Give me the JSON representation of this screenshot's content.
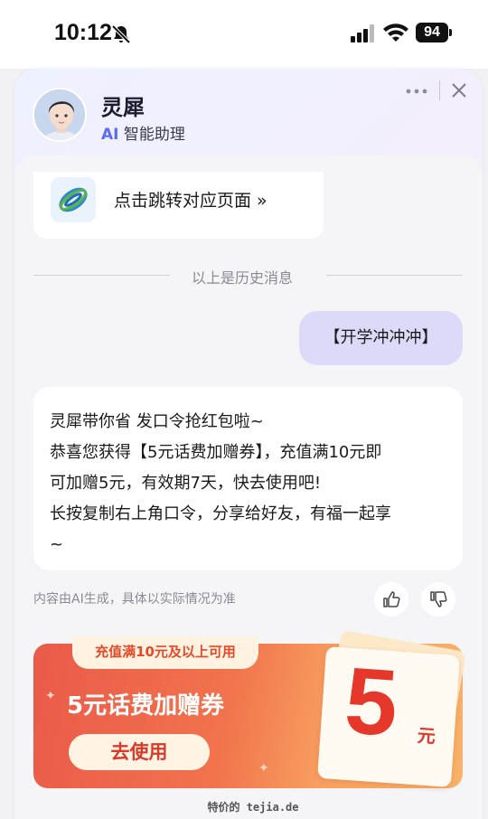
{
  "status_bar": {
    "time": "10:12",
    "battery": "94"
  },
  "assistant": {
    "name": "灵犀",
    "subtitle_ai": "AI",
    "subtitle_rest": "智能助理"
  },
  "link_card": {
    "text": "点击跳转对应页面 »"
  },
  "history_label": "以上是历史消息",
  "user_message": "【开学冲冲冲】",
  "bot_message": {
    "lines": [
      "灵犀带你省 发口令抢红包啦~",
      "恭喜您获得【5元话费加赠券】，充值满10元即",
      "可加赠5元，有效期7天，快去使用吧!",
      "长按复制右上角口令，分享给好友，有福一起享",
      "~"
    ]
  },
  "disclaimer": "内容由AI生成，具体以实际情况为准",
  "coupon": {
    "condition": "充值满10元及以上可用",
    "title": "5元话费加赠券",
    "button": "去使用",
    "amount": "5",
    "unit": "元"
  },
  "watermark": "特价的 tejia.de",
  "colors": {
    "accent": "#5b6cf0",
    "user_bubble": "#dcdaf8",
    "coupon_red": "#e5372a"
  },
  "icons": [
    "bell-off-icon",
    "signal-icon",
    "wifi-icon",
    "more-icon",
    "close-icon",
    "china-mobile-logo",
    "thumbs-up-icon",
    "thumbs-down-icon"
  ]
}
